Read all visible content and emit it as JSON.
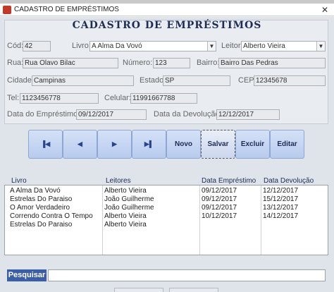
{
  "window": {
    "title": "CADASTRO DE EMPRÉSTIMOS"
  },
  "form": {
    "title": "CADASTRO DE EMPRÉSTIMOS",
    "cod": {
      "label": "Cód:",
      "value": "42"
    },
    "livro": {
      "label": "Livro:",
      "value": "A Alma Da Vovó"
    },
    "leitor": {
      "label": "Leitor:",
      "value": "Alberto Vieira"
    },
    "rua": {
      "label": "Rua:",
      "value": "Rua Olavo Bilac"
    },
    "numero": {
      "label": "Número:",
      "value": "123"
    },
    "bairro": {
      "label": "Bairro:",
      "value": "Bairro Das Pedras"
    },
    "cidade": {
      "label": "Cidade:",
      "value": "Campinas"
    },
    "estado": {
      "label": "Estado:",
      "value": "SP"
    },
    "cep": {
      "label": "CEP:",
      "value": "12345678"
    },
    "tel": {
      "label": "Tel:",
      "value": "1123456778"
    },
    "celular": {
      "label": "Celular:",
      "value": "11991667788"
    },
    "data_emprestimo": {
      "label": "Data do Empréstimo:",
      "value": "09/12/2017"
    },
    "data_devolucao": {
      "label": "Data da Devolução:",
      "value": "12/12/2017"
    }
  },
  "toolbar": {
    "first_icon": "first-record-icon",
    "prev_icon": "previous-record-icon",
    "next_icon": "next-record-icon",
    "last_icon": "last-record-icon",
    "novo": "Novo",
    "salvar": "Salvar",
    "excluir": "Excluir",
    "editar": "Editar"
  },
  "list": {
    "headers": [
      "Livro",
      "Leitores",
      "Data Empréstimo",
      "Data Devolução"
    ],
    "rows": [
      [
        "A Alma Da Vovó",
        "Alberto Vieira",
        "09/12/2017",
        "12/12/2017"
      ],
      [
        "Estrelas Do Paraiso",
        "João Guilherme",
        "09/12/2017",
        "15/12/2017"
      ],
      [
        "O Amor Verdadeiro",
        "João Guilherme",
        "09/12/2017",
        "13/12/2017"
      ],
      [
        "Correndo Contra O Tempo",
        "Alberto Vieira",
        "10/12/2017",
        "14/12/2017"
      ],
      [
        "Estrelas Do Paraiso",
        "Alberto Vieira",
        "",
        ""
      ]
    ]
  },
  "search": {
    "label": "Pesquisar",
    "value": ""
  },
  "colors": {
    "accent": "#3c5ea8",
    "button": "#c6d6f2",
    "title": "#1d2d54"
  }
}
